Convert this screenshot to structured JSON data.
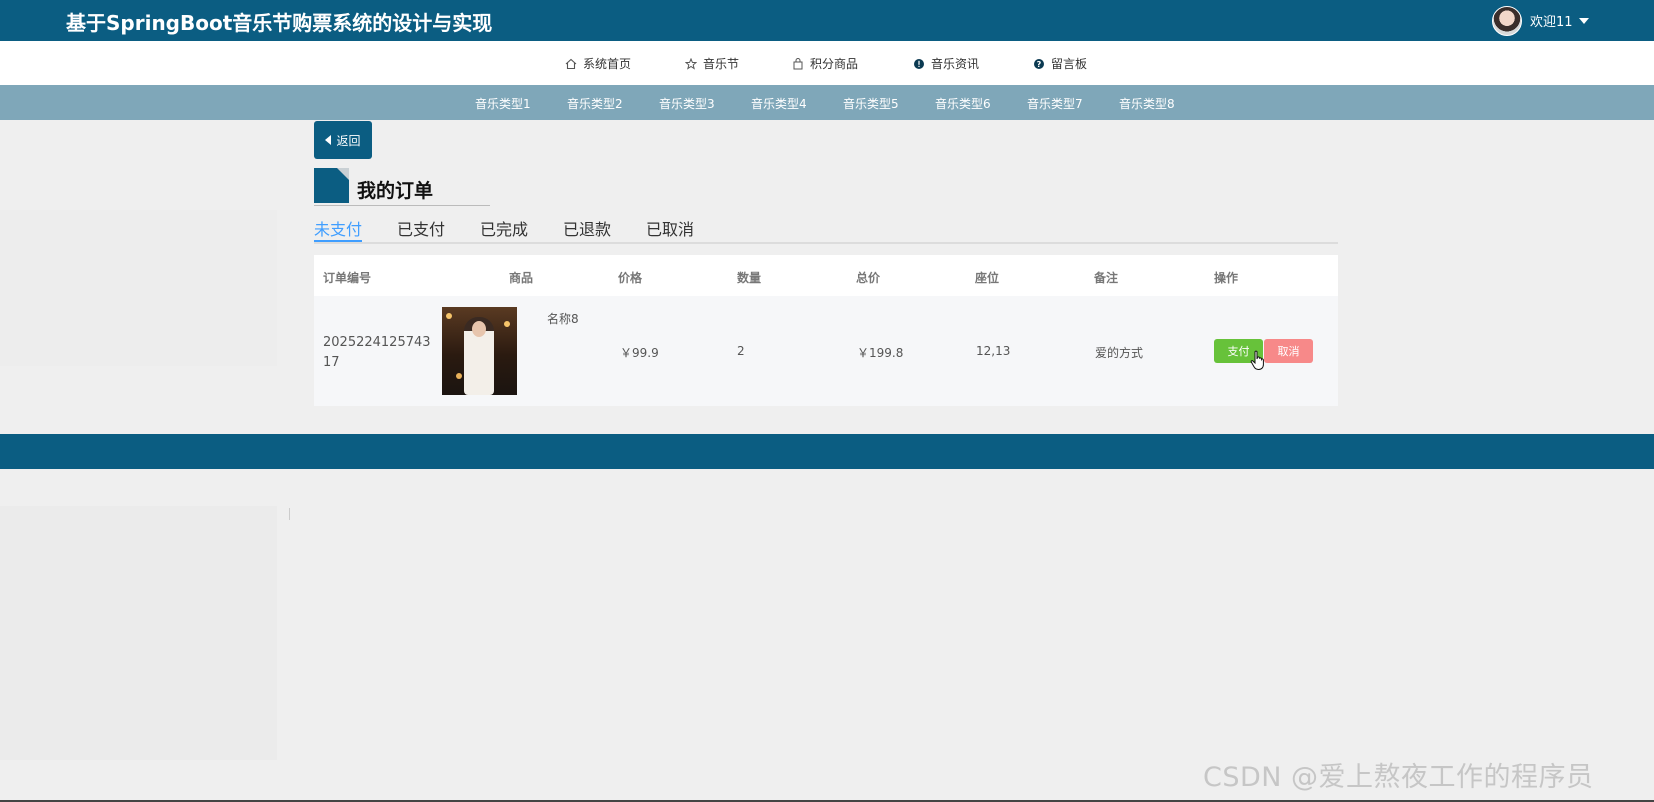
{
  "header": {
    "title": "基于SpringBoot音乐节购票系统的设计与实现",
    "welcome": "欢迎11"
  },
  "nav": {
    "items": [
      {
        "label": "系统首页",
        "icon": "home-icon"
      },
      {
        "label": "音乐节",
        "icon": "star-icon"
      },
      {
        "label": "积分商品",
        "icon": "bag-icon"
      },
      {
        "label": "音乐资讯",
        "icon": "info-icon"
      },
      {
        "label": "留言板",
        "icon": "question-icon"
      }
    ]
  },
  "categories": [
    "音乐类型1",
    "音乐类型2",
    "音乐类型3",
    "音乐类型4",
    "音乐类型5",
    "音乐类型6",
    "音乐类型7",
    "音乐类型8"
  ],
  "back_label": "返回",
  "page_title": "我的订单",
  "tabs": [
    "未支付",
    "已支付",
    "已完成",
    "已退款",
    "已取消"
  ],
  "active_tab": "未支付",
  "table": {
    "headers": [
      "订单编号",
      "商品",
      "价格",
      "数量",
      "总价",
      "座位",
      "备注",
      "操作"
    ],
    "rows": [
      {
        "order_no": "202522412574317",
        "product_name": "名称8",
        "price": "￥99.9",
        "quantity": "2",
        "total": "￥199.8",
        "seat": "12,13",
        "remark": "爱的方式",
        "pay_label": "支付",
        "cancel_label": "取消"
      }
    ]
  },
  "watermark": "CSDN @爱上熬夜工作的程序员",
  "colors": {
    "header_bg": "#0b5d82",
    "category_bar_bg": "#7fa7b9",
    "tab_active": "#409eff",
    "pay_button": "#67c23a",
    "cancel_button": "#f78989"
  }
}
